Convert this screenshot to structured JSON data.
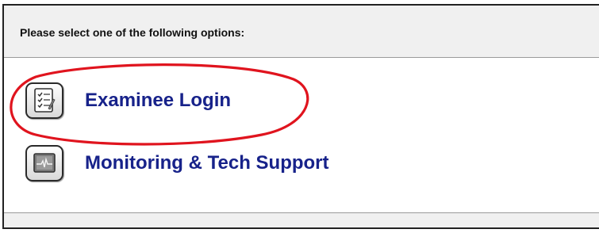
{
  "header": {
    "prompt": "Please select one of the following options:"
  },
  "options": [
    {
      "label": "Examinee Login",
      "icon": "checklist-icon"
    },
    {
      "label": "Monitoring & Tech Support",
      "icon": "monitor-waveform-icon"
    }
  ],
  "annotation": {
    "color": "#e0141e"
  },
  "colors": {
    "link": "#17228a",
    "header_bg": "#f0f0f0"
  }
}
